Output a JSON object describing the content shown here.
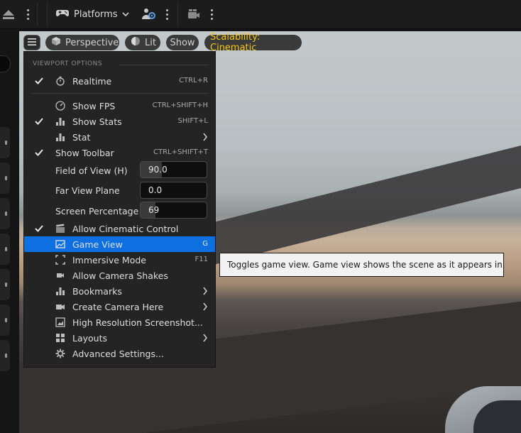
{
  "toolbar": {
    "platforms_label": "Platforms"
  },
  "viewport_toolbar": {
    "perspective_label": "Perspective",
    "lit_label": "Lit",
    "show_label": "Show",
    "scalability_label": "Scalability: Cinematic",
    "scalability_color": "#f5c518"
  },
  "menu": {
    "heading": "VIEWPORT OPTIONS",
    "realtime": {
      "label": "Realtime",
      "shortcut": "CTRL+R",
      "checked": true
    },
    "show_fps": {
      "label": "Show FPS",
      "shortcut": "CTRL+SHIFT+H",
      "checked": false
    },
    "show_stats": {
      "label": "Show Stats",
      "shortcut": "SHIFT+L",
      "checked": true
    },
    "stat": {
      "label": "Stat"
    },
    "show_toolbar": {
      "label": "Show Toolbar",
      "shortcut": "CTRL+SHIFT+T",
      "checked": true
    },
    "field_of_view": {
      "label": "Field of View (H)",
      "value": "90.0",
      "fill_fraction": 0.32
    },
    "far_view_plane": {
      "label": "Far View Plane",
      "value": "0.0",
      "fill_fraction": 0.0
    },
    "screen_percentage": {
      "label": "Screen Percentage",
      "value": "69",
      "fill_fraction": 0.23
    },
    "allow_cinematic_control": {
      "label": "Allow Cinematic Control",
      "checked": true
    },
    "game_view": {
      "label": "Game View",
      "shortcut": "G",
      "highlighted": true,
      "highlight_color": "#0e70e0"
    },
    "immersive_mode": {
      "label": "Immersive Mode",
      "shortcut": "F11"
    },
    "allow_camera_shakes": {
      "label": "Allow Camera Shakes"
    },
    "bookmarks": {
      "label": "Bookmarks"
    },
    "create_camera_here": {
      "label": "Create Camera Here"
    },
    "high_res_screenshot": {
      "label": "High Resolution Screenshot..."
    },
    "layouts": {
      "label": "Layouts"
    },
    "advanced_settings": {
      "label": "Advanced Settings..."
    }
  },
  "tooltip": {
    "text": "Toggles game view.  Game view shows the scene as it appears in game"
  }
}
